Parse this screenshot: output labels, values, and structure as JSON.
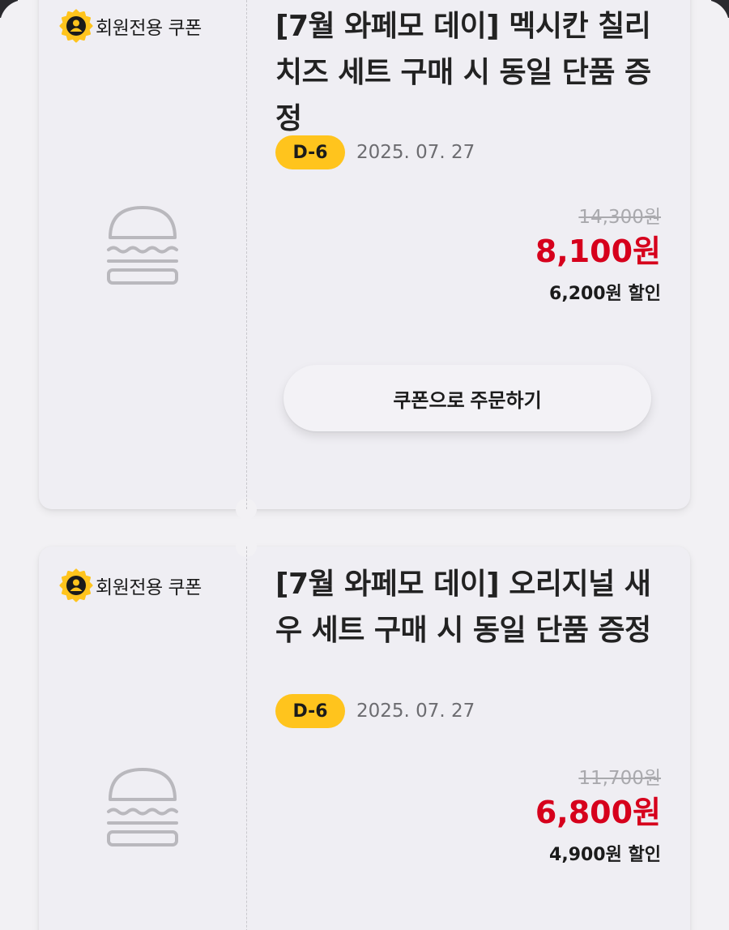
{
  "colors": {
    "accent": "#ffc41d",
    "price": "#d6001c",
    "background": "#f2f1f4"
  },
  "coupons": [
    {
      "badge_icon": "member-person-icon",
      "badge_label": "회원전용 쿠폰",
      "product_icon": "burger-icon",
      "title": "[7월 와페모 데이] 멕시칸 칠리 치즈 세트 구매 시 동일 단품 증정",
      "dday": "D-6",
      "expiry_date": "2025. 07. 27",
      "original_price": "14,300원",
      "sale_price": "8,100원",
      "discount": "6,200원 할인",
      "order_button_label": "쿠폰으로 주문하기"
    },
    {
      "badge_icon": "member-person-icon",
      "badge_label": "회원전용 쿠폰",
      "product_icon": "burger-icon",
      "title": "[7월 와페모 데이] 오리지널 새우 세트 구매 시 동일 단품 증정",
      "dday": "D-6",
      "expiry_date": "2025. 07. 27",
      "original_price": "11,700원",
      "sale_price": "6,800원",
      "discount": "4,900원 할인"
    }
  ]
}
